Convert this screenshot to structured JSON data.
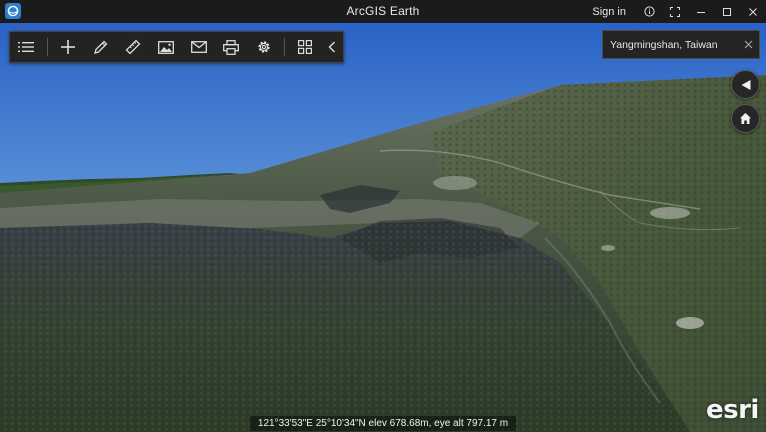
{
  "window": {
    "title": "ArcGIS Earth",
    "app_icon": "arcgis-earth-icon",
    "signin_label": "Sign in",
    "controls": [
      "info-icon",
      "fullscreen-icon",
      "minimize-icon",
      "maximize-icon",
      "close-icon"
    ]
  },
  "toolbar": {
    "tools": [
      "layers-list-icon",
      "add-icon",
      "draw-icon",
      "measure-icon",
      "image-icon",
      "mail-icon",
      "print-icon",
      "settings-icon",
      "apps-grid-icon",
      "collapse-chevron-icon"
    ]
  },
  "search": {
    "value": "Yangmingshan, Taiwan",
    "clear_icon": "close-icon"
  },
  "navigation": {
    "compass_icon": "compass-arrow-icon",
    "home_icon": "home-icon"
  },
  "status": {
    "coordinates": "121°33'53\"E  25°10'34\"N elev  678.68m,  eye alt  797.17 m"
  },
  "attribution": {
    "logo_text": "esri"
  },
  "colors": {
    "titlebar": "#1b1b1b",
    "panel": "#232323",
    "accent": "#2d7fd0",
    "sky_top": "#2f68c9",
    "sky_horizon": "#cfe3f3",
    "terrain": "#3e4a3e"
  }
}
